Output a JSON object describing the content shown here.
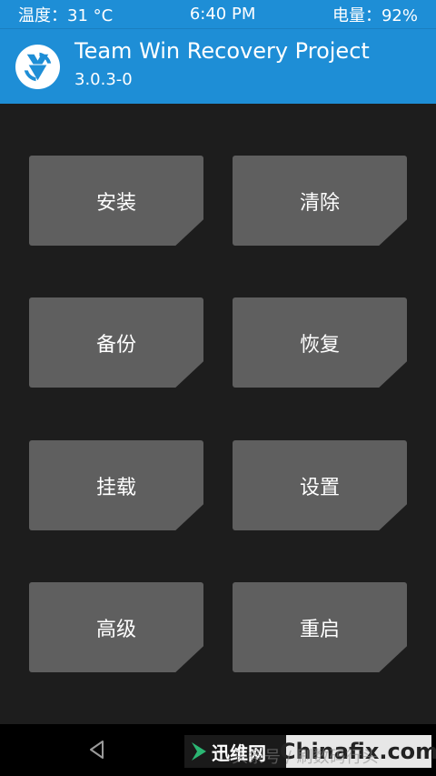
{
  "status_bar": {
    "temperature": "温度：31 °C",
    "time": "6:40 PM",
    "battery": "电量：92%"
  },
  "header": {
    "title": "Team Win Recovery Project",
    "version": "3.0.3-0",
    "logo_icon": "twrp-logo-icon"
  },
  "menu": {
    "install": "安装",
    "wipe": "清除",
    "backup": "备份",
    "restore": "恢复",
    "mount": "挂载",
    "settings": "设置",
    "advanced": "高级",
    "reboot": "重启"
  },
  "nav_bar": {
    "back_icon": "back-triangle-icon"
  },
  "watermark": {
    "brand_cn": "迅维网",
    "brand_site": "Chinafix.com",
    "overlay": "头条号 / 刷数码行头"
  },
  "colors": {
    "accent": "#1e8ed6",
    "button": "#5f5f5f",
    "background": "#1d1d1d",
    "nav_background": "#000000"
  }
}
